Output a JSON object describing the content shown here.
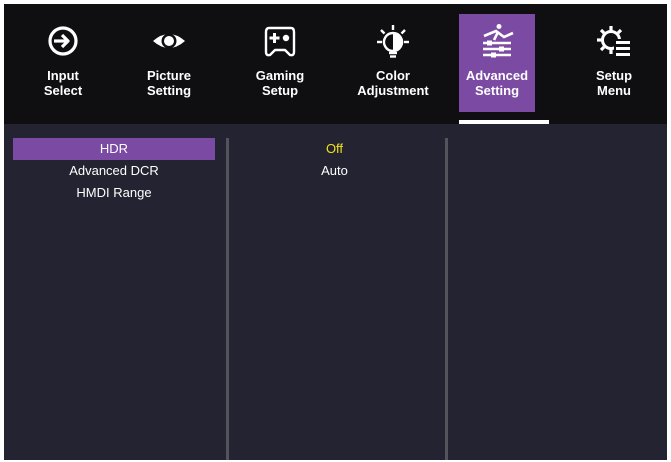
{
  "tabs": [
    {
      "label": "Input\nSelect",
      "icon": "input-select-icon",
      "active": false
    },
    {
      "label": "Picture\nSetting",
      "icon": "eye-icon",
      "active": false
    },
    {
      "label": "Gaming\nSetup",
      "icon": "gamepad-icon",
      "active": false
    },
    {
      "label": "Color\nAdjustment",
      "icon": "color-bulb-icon",
      "active": false
    },
    {
      "label": "Advanced\nSetting",
      "icon": "advanced-sliders-icon",
      "active": true
    },
    {
      "label": "Setup\nMenu",
      "icon": "gear-menu-icon",
      "active": false
    }
  ],
  "menu": {
    "items": [
      "HDR",
      "Advanced DCR",
      "HMDI Range"
    ],
    "selected_index": 0
  },
  "options": {
    "items": [
      "Off",
      "Auto"
    ],
    "current_index": 0
  },
  "colors": {
    "background": "#232331",
    "tab_bar": "#0f0f12",
    "accent_purple": "#7b4aa3",
    "current_value": "#f2e21a",
    "text": "#ffffff",
    "divider": "#53535c"
  }
}
